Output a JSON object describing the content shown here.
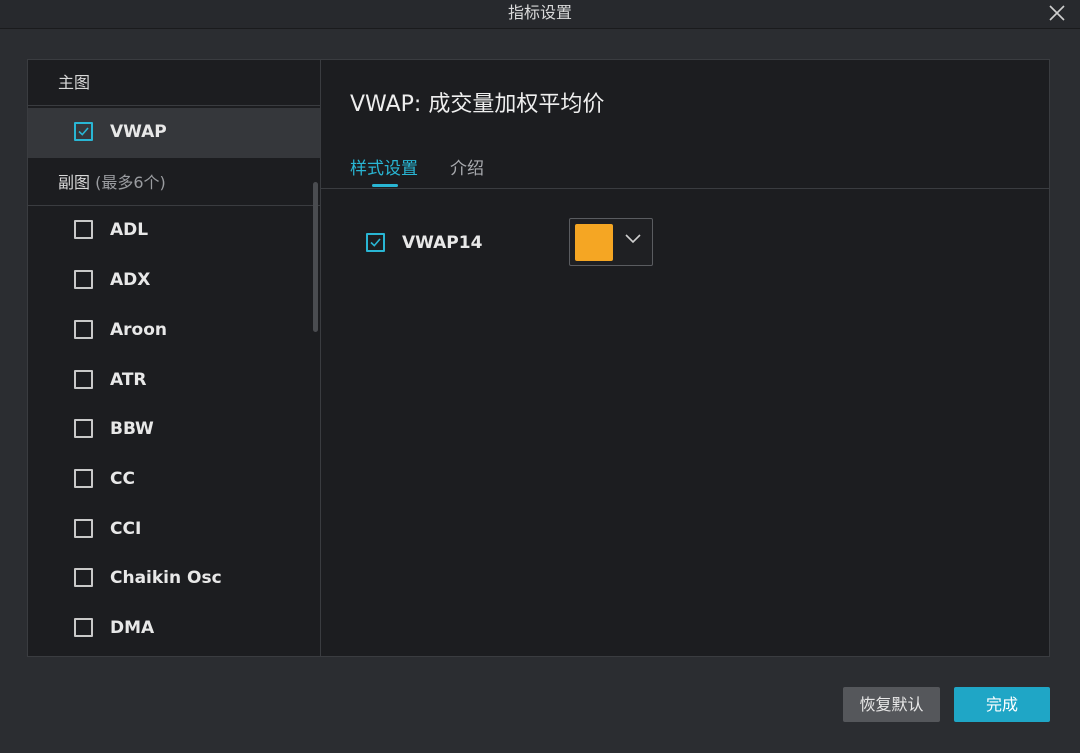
{
  "window": {
    "title": "指标设置"
  },
  "main_section": {
    "header": "主图",
    "items": [
      {
        "label": "VWAP",
        "checked": true,
        "selected": true
      }
    ]
  },
  "sub_section": {
    "header": "副图",
    "header_note": "(最多6个)",
    "items": [
      {
        "label": "ADL",
        "checked": false
      },
      {
        "label": "ADX",
        "checked": false
      },
      {
        "label": "Aroon",
        "checked": false
      },
      {
        "label": "ATR",
        "checked": false
      },
      {
        "label": "BBW",
        "checked": false
      },
      {
        "label": "CC",
        "checked": false
      },
      {
        "label": "CCI",
        "checked": false
      },
      {
        "label": "Chaikin Osc",
        "checked": false
      },
      {
        "label": "DMA",
        "checked": false
      }
    ]
  },
  "detail": {
    "title": "VWAP: 成交量加权平均价",
    "tabs": [
      {
        "label": "样式设置",
        "active": true
      },
      {
        "label": "介绍",
        "active": false
      }
    ],
    "settings": [
      {
        "label": "VWAP14",
        "checked": true,
        "color": "#f5a623"
      }
    ]
  },
  "footer": {
    "reset_label": "恢复默认",
    "done_label": "完成"
  },
  "colors": {
    "accent": "#29b6d4",
    "primary_button": "#1fa6c6",
    "line_color": "#f5a623"
  },
  "icons": {
    "close": "close-icon",
    "checkbox": "checkbox-icon",
    "chevron": "chevron-down-icon"
  }
}
